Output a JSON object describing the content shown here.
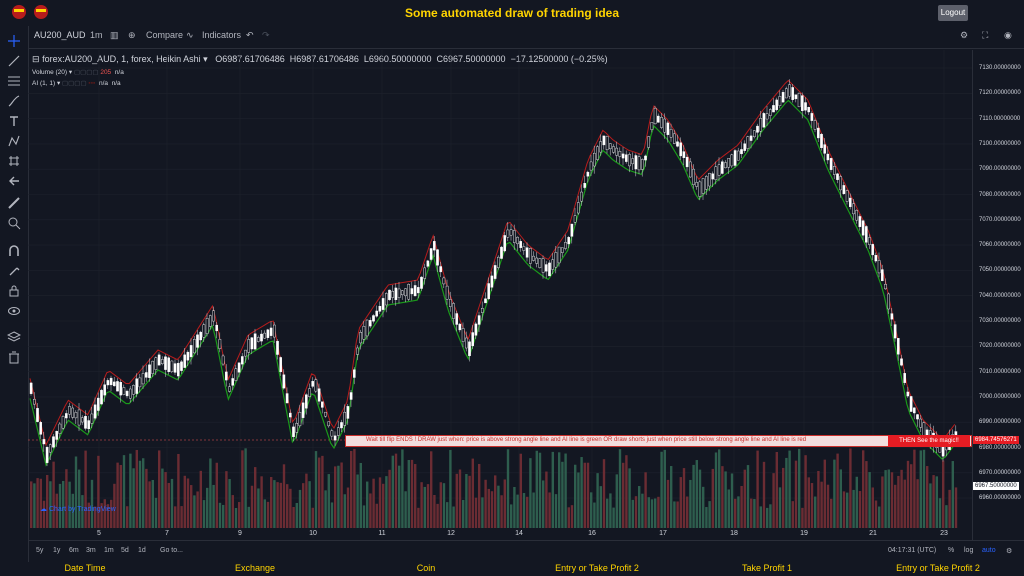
{
  "title": "Some automated draw of trading idea",
  "logout_label": "Logout",
  "toolbar": {
    "symbol": "AU200_AUD",
    "interval": "1m",
    "compare_label": "Compare",
    "indicators_label": "Indicators"
  },
  "legend": {
    "symbol_line": "forex:AU200_AUD, 1, forex, Heikin Ashi",
    "open": "O6987.61706486",
    "high": "H6987.61706486",
    "low": "L6960.50000000",
    "close": "C6967.50000000",
    "change": "−17.12500000 (−0.25%)",
    "volume_label": "Volume (20)",
    "volume_value": "205",
    "volume_na": "n/a",
    "ai_label": "AI (1, 1)",
    "ai_na1": "n/a",
    "ai_na2": "n/a"
  },
  "price_axis": [
    "7130.00000000",
    "7120.00000000",
    "7110.00000000",
    "7100.00000000",
    "7090.00000000",
    "7080.00000000",
    "7070.00000000",
    "7060.00000000",
    "7050.00000000",
    "7040.00000000",
    "7030.00000000",
    "7020.00000000",
    "7010.00000000",
    "7000.00000000",
    "6990.00000000",
    "6980.00000000",
    "6970.00000000",
    "6960.00000000"
  ],
  "price_tags": {
    "red": "6984.74576271",
    "current": "6967.50000000"
  },
  "date_labels": [
    "5",
    "7",
    "9",
    "10",
    "11",
    "12",
    "14",
    "16",
    "17",
    "18",
    "19",
    "21",
    "23"
  ],
  "banner": {
    "left_text": "Wait till flip ENDS !   DRAW just when:  price is above strong angle line and AI line is green         OR        draw shorts just when price still below strong angle line and AI line is red",
    "right_text": "THEN See the magic!!"
  },
  "watermark": "Chart by TradingView",
  "bottom": {
    "ranges": [
      "5y",
      "1y",
      "6m",
      "3m",
      "1m",
      "5d",
      "1d"
    ],
    "goto": "Go to...",
    "time": "04:17:31 (UTC)",
    "pct": "%",
    "log": "log",
    "auto": "auto"
  },
  "footer": [
    "Date Time",
    "Exchange",
    "Coin",
    "Entry or Take Profit 2",
    "Take Profit 1",
    "Entry or Take Profit 2"
  ],
  "colors": {
    "up": "#26a69a",
    "down": "#ef5350",
    "green_line": "#1a9a1a",
    "red_line": "#b71c1c",
    "accent": "#ffd400"
  },
  "icons": [
    "crosshair-icon",
    "trendline-icon",
    "fib-icon",
    "brush-icon",
    "text-icon",
    "pattern-icon",
    "prediction-icon",
    "back-icon",
    "ruler-icon",
    "zoom-icon",
    "magnet-icon",
    "lock-icon",
    "unlock-icon",
    "eye-icon",
    "layers-icon",
    "trash-icon"
  ]
}
